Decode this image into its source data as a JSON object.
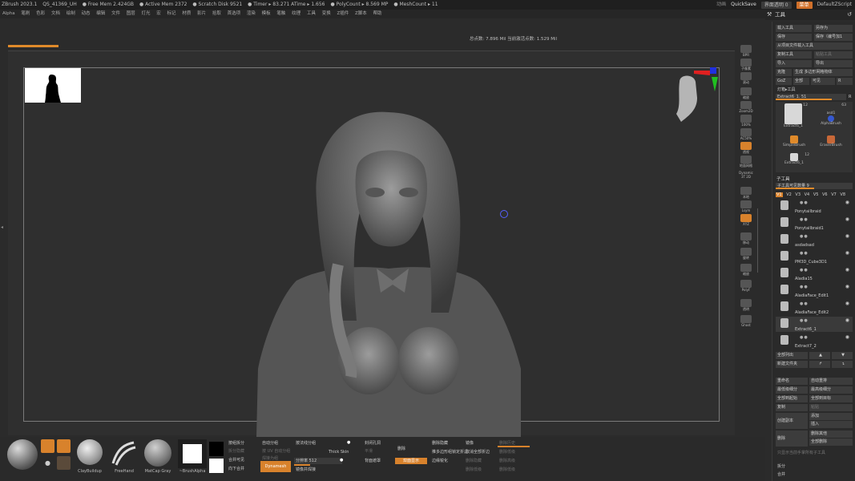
{
  "titlebar": {
    "stats": [
      "ZBrush 2023.1",
      "QS_41369_UH",
      "● Free Mem 2.424GB",
      "● Active Mem 2372",
      "● Scratch Disk 9521",
      "● Timer ▸ 83.271 ATime ▸ 1.656",
      "● PolyCount ▸ 8.569 MP",
      "● MeshCount ▸ 11"
    ],
    "right_items": [
      "动画",
      "QuickSave",
      "界面透明 0",
      "菜单",
      "DefaultZScript"
    ]
  },
  "menu": [
    "Alpha",
    "笔刷",
    "色彩",
    "文档",
    "绘制",
    "动态",
    "编辑",
    "文件",
    "图层",
    "灯光",
    "宏",
    "标记",
    "材质",
    "影片",
    "拾取",
    "首选项",
    "渲染",
    "模板",
    "笔触",
    "纹理",
    "工具",
    "变换",
    "Z插件",
    "Z脚本",
    "帮助"
  ],
  "tool_header": {
    "title": "工具"
  },
  "canvas": {
    "poly_info": "总点数: 7.896 Mil 当前激活点数: 1.529 Mil"
  },
  "icon_col": [
    "BPR",
    "子像素",
    "滚动",
    "缩放",
    "Zoom2D",
    "100%",
    "AC50%",
    "透视",
    "地面网格",
    "Dynamic 3T 2D",
    "本地",
    "Lsym",
    "XYZ",
    "移动",
    "旋转",
    "缩放",
    "PolyF",
    "透明",
    "Ghost"
  ],
  "right_panel": {
    "buttons": [
      [
        "载入工具",
        "另存为"
      ],
      [
        "保存",
        "保存（编号加1"
      ],
      [
        "从项目文件载入工具"
      ],
      [
        "复制工具",
        "粘贴工具"
      ],
      [
        "导入",
        "导出"
      ],
      [
        "克隆",
        "生成 多边形网格物体"
      ],
      [
        "GoZ",
        "全部",
        "可见",
        "R"
      ],
      [
        "灯箱▸工具"
      ]
    ],
    "tool_slider": "Extract6_1. 51",
    "tool_slider_r": "R",
    "tools": [
      {
        "name": "Extract6_1",
        "count": "12"
      },
      {
        "name": "AlphaBrush",
        "top": "asd1",
        "count": "63"
      },
      {
        "name": "SimpleBrush"
      },
      {
        "name": "EraserBrush"
      },
      {
        "name": "Extract6_1",
        "count": "12"
      }
    ],
    "subtool_title": "子工具",
    "visible_count": "子工具可见数量 9",
    "vtabs": [
      "V1",
      "V2",
      "V3",
      "V4",
      "V5",
      "V6",
      "V7",
      "V8"
    ],
    "subtools": [
      "Ponytailbraid",
      "Ponytailbraid1",
      "asdadsad",
      "PM3D_Cube3D1",
      "Aladia15",
      "AladiaFace_Edit1",
      "AladiaFace_Edit2",
      "Extract6_1",
      "Extract7_2"
    ],
    "lower_buttons": [
      [
        "全部列出",
        "▲",
        "▼"
      ],
      [
        "新建文件夹",
        "↱",
        "↴"
      ],
      [
        "重命名",
        "自动重排"
      ],
      [
        "最低级细分",
        "最高级细分"
      ],
      [
        "全部到起始",
        "全部到目标"
      ],
      [
        "复制",
        "粘贴"
      ],
      [
        "创建副本",
        "添加",
        "插入"
      ],
      [
        "删除",
        "删除其他",
        "全部删除"
      ]
    ],
    "dim_text": "只显示当前手掌所有子工具",
    "split_label": "拆分",
    "merge_label": "合并"
  },
  "bottom": {
    "brushes": [
      "ClayBuildup",
      "FreeHand",
      "MatCap Gray",
      "~BrushAlpha"
    ],
    "col1": [
      "按组拆分",
      "拆分隐藏",
      "合并可见",
      "向下合并"
    ],
    "col2": [
      "自动分组",
      "按 UV 自动分组",
      "焊接为组",
      "Dynamesh"
    ],
    "col3": [
      "按法线分组",
      "Thick Skin",
      "分辨率 512",
      "镜像并焊接"
    ],
    "col4": [
      "封闭孔洞",
      "平滑",
      "背面遮罩",
      "删除"
    ],
    "col5": [
      "删除隐藏",
      "推多边形组锁定折边",
      "双面显示",
      "边缘锐化"
    ],
    "col6": [
      "镜像",
      "取消全部折边",
      "删除隐藏",
      "删除低级"
    ],
    "col7": [
      "删除历史",
      "删除低级",
      "删除高级",
      "删除低级"
    ]
  }
}
